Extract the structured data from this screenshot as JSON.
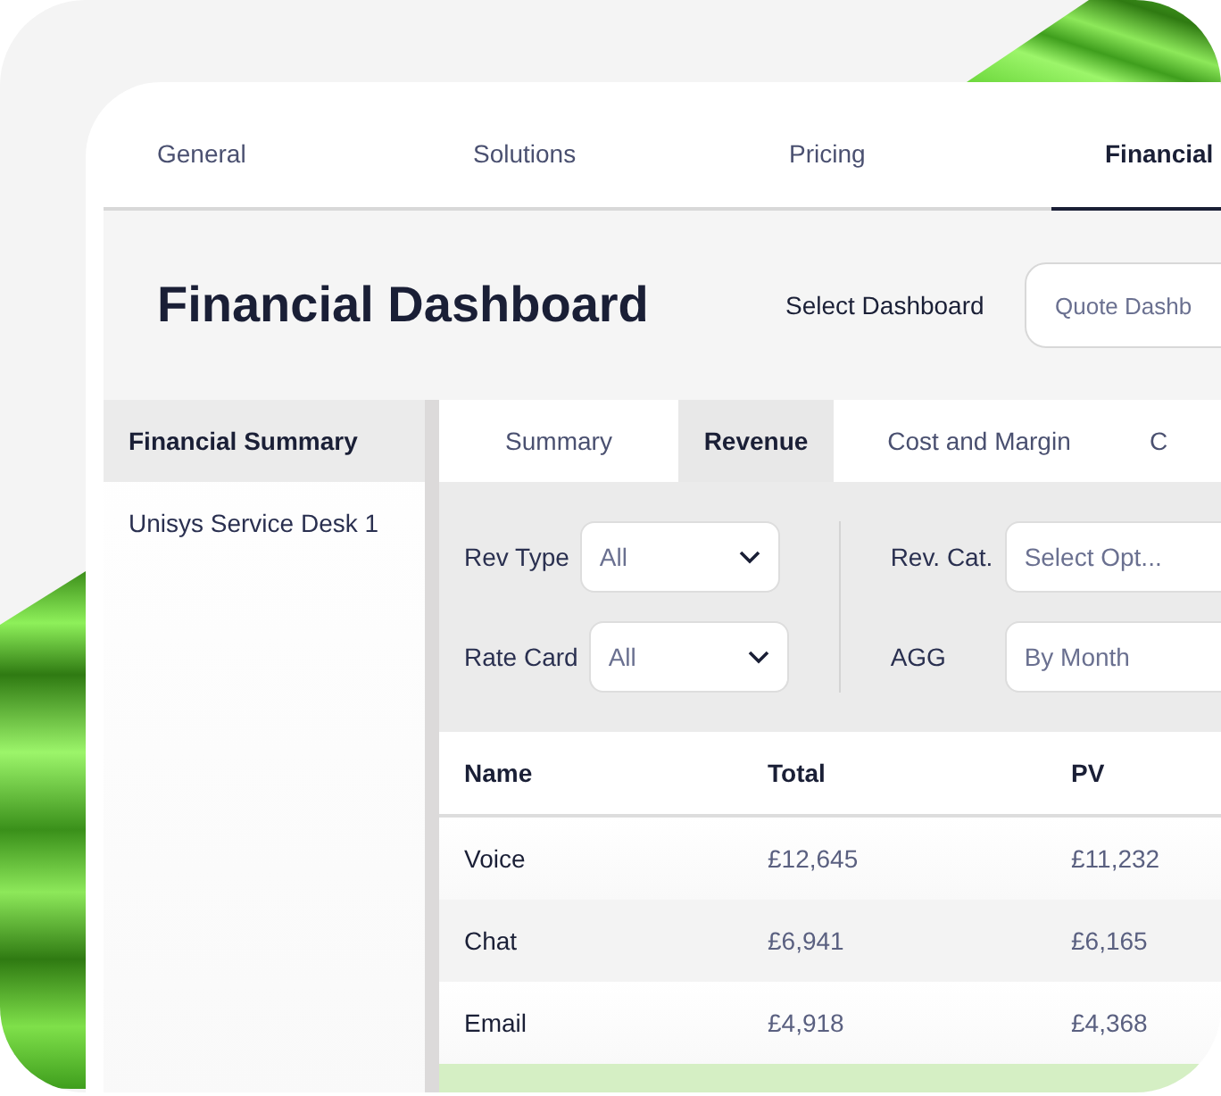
{
  "tabs": [
    {
      "label": "General",
      "selected": false
    },
    {
      "label": "Solutions",
      "selected": false
    },
    {
      "label": "Pricing",
      "selected": false
    },
    {
      "label": "Financial",
      "selected": true
    }
  ],
  "header": {
    "title": "Financial Dashboard",
    "select_label": "Select Dashboard",
    "select_value": "Quote Dashb"
  },
  "sidebar": {
    "items": [
      {
        "label": "Financial Summary",
        "selected": true
      },
      {
        "label": "Unisys Service Desk 1",
        "selected": false
      }
    ]
  },
  "subtabs": [
    {
      "label": "Summary",
      "selected": false
    },
    {
      "label": "Revenue",
      "selected": true
    },
    {
      "label": "Cost and Margin",
      "selected": false
    },
    {
      "label": "C",
      "selected": false
    }
  ],
  "filters": {
    "left": [
      {
        "label": "Rev Type",
        "value": "All"
      },
      {
        "label": "Rate Card",
        "value": "All"
      }
    ],
    "right": [
      {
        "label": "Rev. Cat.",
        "placeholder": "Select Opt..."
      },
      {
        "label": "AGG",
        "value": "By Month"
      }
    ]
  },
  "table": {
    "columns": [
      "Name",
      "Total",
      "PV"
    ],
    "rows": [
      {
        "cells": [
          "Voice",
          "£12,645",
          "£11,232"
        ],
        "highlighted": false
      },
      {
        "cells": [
          "Chat",
          "£6,941",
          "£6,165"
        ],
        "highlighted": false
      },
      {
        "cells": [
          "Email",
          "£4,918",
          "£4,368"
        ],
        "highlighted": false
      },
      {
        "highlighted": true
      }
    ]
  }
}
